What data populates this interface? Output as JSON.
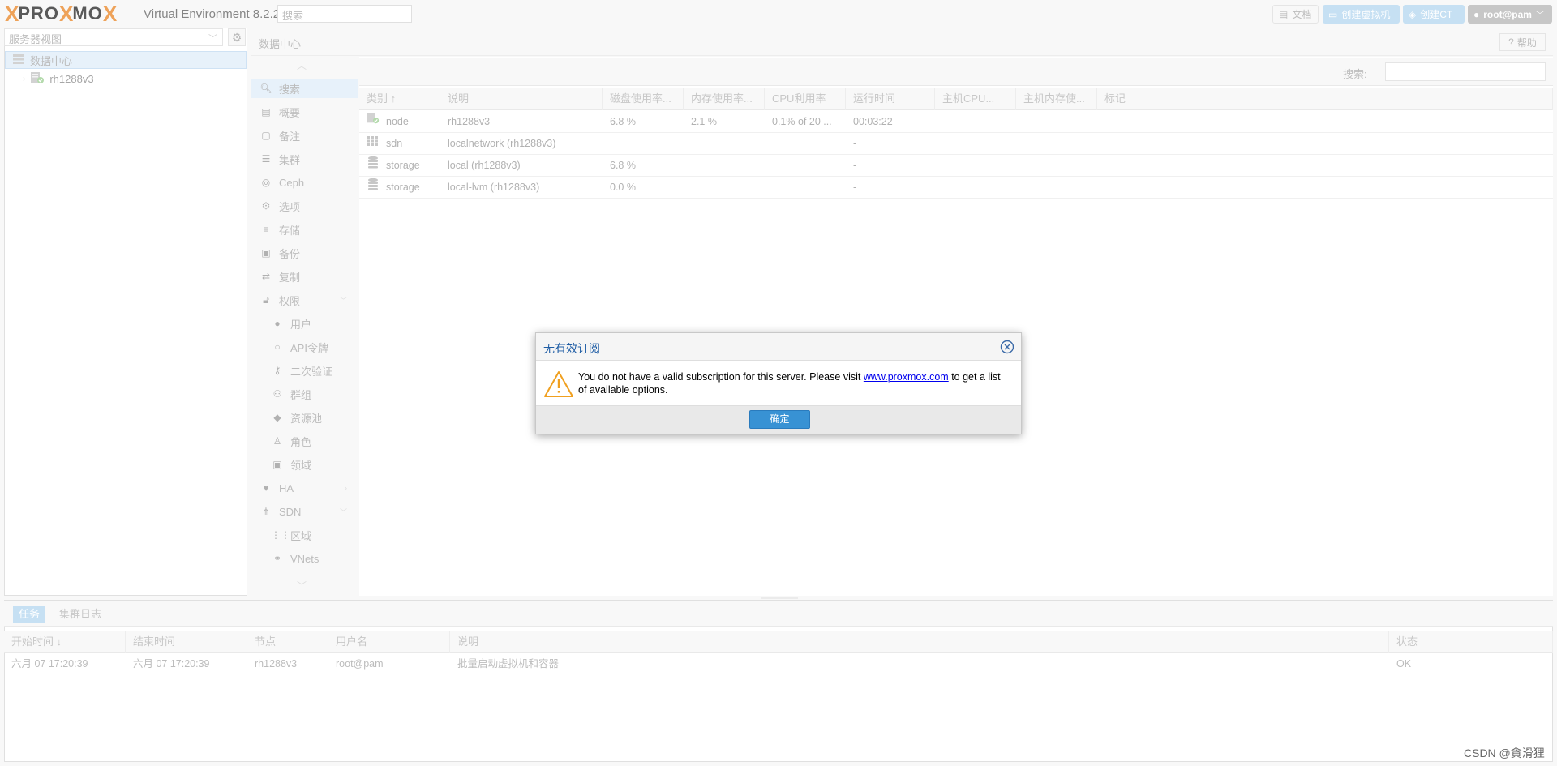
{
  "header": {
    "logo_x": "X",
    "logo_prox": "PRO",
    "logo_mo": "MO",
    "version": "Virtual Environment 8.2.2",
    "search_placeholder": "搜索",
    "doc_button": "文档",
    "create_vm_button": "创建虚拟机",
    "create_ct_button": "创建CT",
    "user_button": "root@pam",
    "colors": {
      "accent": "#a8d0ed",
      "logo_orange": "#e57000"
    }
  },
  "left": {
    "view_select": "服务器视图",
    "tree": [
      {
        "label": "数据中心",
        "icon": "datacenter-icon"
      },
      {
        "label": "rh1288v3",
        "icon": "node-online-icon"
      }
    ]
  },
  "content": {
    "title": "数据中心",
    "help_button": "帮助",
    "nav": [
      {
        "label": "搜索",
        "icon": "search-icon",
        "active": true,
        "sub": false
      },
      {
        "label": "概要",
        "icon": "book-icon",
        "sub": false
      },
      {
        "label": "备注",
        "icon": "sticky-note-icon",
        "sub": false
      },
      {
        "label": "集群",
        "icon": "server-icon",
        "sub": false
      },
      {
        "label": "Ceph",
        "icon": "ceph-icon",
        "sub": false
      },
      {
        "label": "选项",
        "icon": "gear-icon",
        "sub": false
      },
      {
        "label": "存储",
        "icon": "database-icon",
        "sub": false
      },
      {
        "label": "备份",
        "icon": "floppy-icon",
        "sub": false
      },
      {
        "label": "复制",
        "icon": "retweet-icon",
        "sub": false
      },
      {
        "label": "权限",
        "icon": "unlock-icon",
        "sub": false,
        "expander": true
      },
      {
        "label": "用户",
        "icon": "user-icon",
        "sub": true
      },
      {
        "label": "API令牌",
        "icon": "user-outline-icon",
        "sub": true
      },
      {
        "label": "二次验证",
        "icon": "key-icon",
        "sub": true
      },
      {
        "label": "群组",
        "icon": "users-icon",
        "sub": true
      },
      {
        "label": "资源池",
        "icon": "tags-icon",
        "sub": true
      },
      {
        "label": "角色",
        "icon": "male-icon",
        "sub": true
      },
      {
        "label": "领域",
        "icon": "id-card-icon",
        "sub": true
      },
      {
        "label": "HA",
        "icon": "heartbeat-icon",
        "sub": false,
        "expander": true
      },
      {
        "label": "SDN",
        "icon": "sdn-icon",
        "sub": false,
        "expander": true
      },
      {
        "label": "区域",
        "icon": "grid-icon",
        "sub": true
      },
      {
        "label": "VNets",
        "icon": "network-icon",
        "sub": true
      }
    ],
    "grid": {
      "search_label": "搜索:",
      "columns": [
        "类别 ↑",
        "说明",
        "磁盘使用率...",
        "内存使用率...",
        "CPU利用率",
        "运行时间",
        "主机CPU...",
        "主机内存使...",
        "标记"
      ],
      "rows": [
        {
          "type": "node",
          "icon": "node-online-icon",
          "desc": "rh1288v3",
          "disk": "6.8 %",
          "mem": "2.1 %",
          "cpu": "0.1% of 20 ...",
          "uptime": "00:03:22"
        },
        {
          "type": "sdn",
          "icon": "grid-icon",
          "desc": "localnetwork (rh1288v3)",
          "disk": "",
          "mem": "",
          "cpu": "",
          "uptime": "-"
        },
        {
          "type": "storage",
          "icon": "database-icon",
          "desc": "local (rh1288v3)",
          "disk": "6.8 %",
          "mem": "",
          "cpu": "",
          "uptime": "-"
        },
        {
          "type": "storage",
          "icon": "database-icon",
          "desc": "local-lvm (rh1288v3)",
          "disk": "0.0 %",
          "mem": "",
          "cpu": "",
          "uptime": "-"
        }
      ]
    }
  },
  "tasks": {
    "tabs": [
      "任务",
      "集群日志"
    ],
    "columns": [
      "开始时间 ↓",
      "结束时间",
      "节点",
      "用户名",
      "说明",
      "状态"
    ],
    "rows": [
      {
        "start": "六月 07 17:20:39",
        "end": "六月 07 17:20:39",
        "node": "rh1288v3",
        "user": "root@pam",
        "desc": "批量启动虚拟机和容器",
        "status": "OK"
      }
    ]
  },
  "dialog": {
    "title": "无有效订阅",
    "message_before": "You do not have a valid subscription for this server. Please visit ",
    "link": "www.proxmox.com",
    "message_after": " to get a list of available options.",
    "ok_button": "确定"
  },
  "watermark": "CSDN @貪滑狸"
}
